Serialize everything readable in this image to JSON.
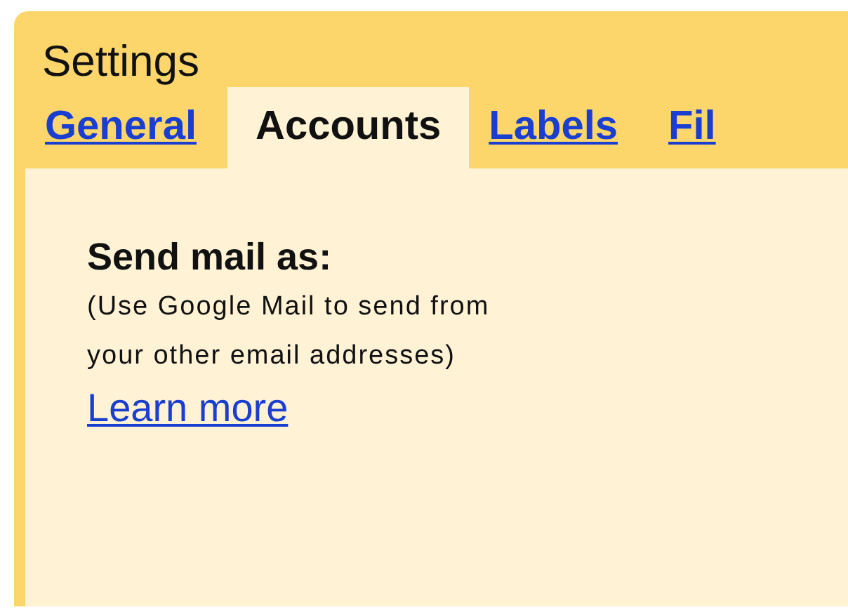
{
  "window": {
    "title": "Settings"
  },
  "tabs": [
    {
      "label": "General",
      "selected": false
    },
    {
      "label": "Accounts",
      "selected": true
    },
    {
      "label": "Labels",
      "selected": false
    },
    {
      "label": "Fil",
      "selected": false
    }
  ],
  "section": {
    "heading": "Send mail as:",
    "description": "(Use Google Mail to send from your other email addresses)",
    "link": "Learn more"
  }
}
